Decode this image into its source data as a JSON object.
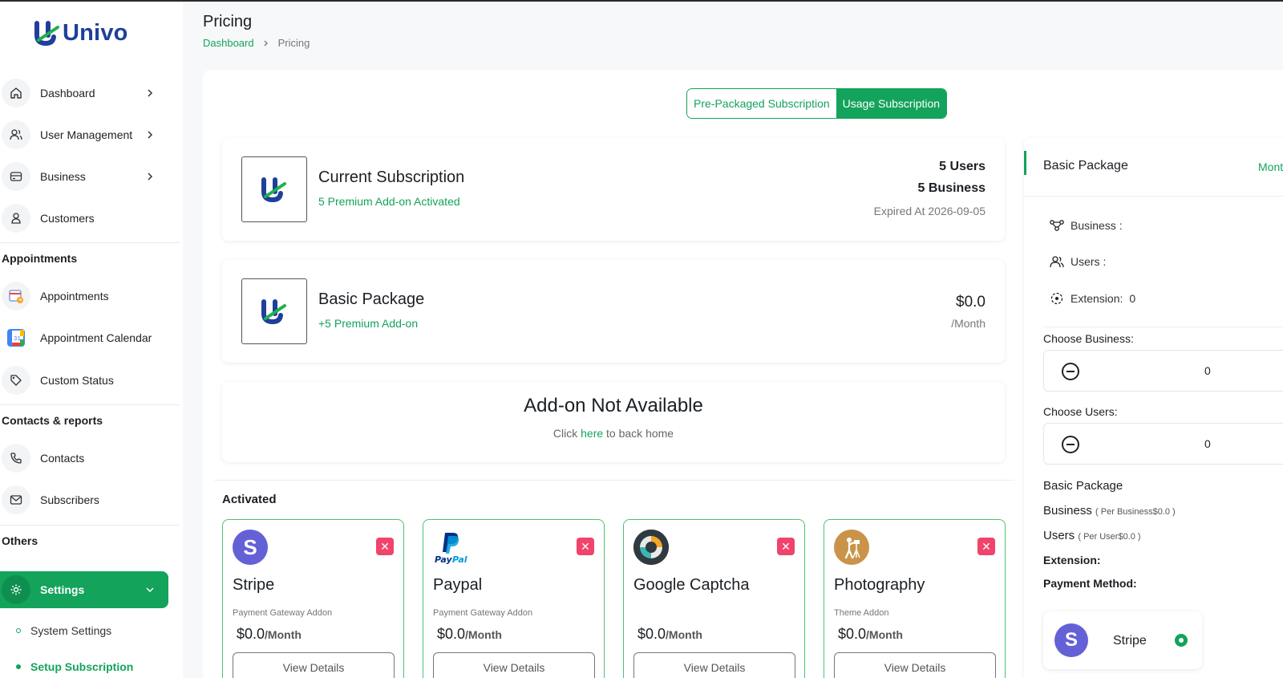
{
  "app": {
    "logo_text": "Univo"
  },
  "sidebar": {
    "items": [
      {
        "label": "Dashboard"
      },
      {
        "label": "User Management"
      },
      {
        "label": "Business"
      },
      {
        "label": "Customers"
      }
    ],
    "sections": [
      {
        "title": "Appointments",
        "items": [
          "Appointments",
          "Appointment Calendar",
          "Custom Status"
        ]
      },
      {
        "title": "Contacts & reports",
        "items": [
          "Contacts",
          "Subscribers"
        ]
      },
      {
        "title": "Others"
      }
    ],
    "active": {
      "label": "Settings"
    },
    "subitems": [
      {
        "label": "System Settings"
      },
      {
        "label": "Setup Subscription"
      }
    ]
  },
  "header": {
    "title": "Pricing",
    "breadcrumb": [
      "Dashboard",
      "Pricing"
    ]
  },
  "toggle": {
    "options": [
      "Pre-Packaged Subscription",
      "Usage Subscription"
    ],
    "selected": "Usage Subscription"
  },
  "current_subscription": {
    "title": "Current Subscription",
    "subtitle": "5 Premium Add-on Activated",
    "users": "5 Users",
    "business": "5 Business",
    "expiry": "Expired At 2026-09-05"
  },
  "package": {
    "title": "Basic Package",
    "subtitle": "+5 Premium Add-on",
    "price": "$0.0",
    "period": "/Month"
  },
  "addon_unavailable": {
    "title": "Add-on Not Available",
    "sub_prefix": "Click",
    "sub_link": "here",
    "sub_suffix": "to back home"
  },
  "activated": {
    "label": "Activated",
    "addons": [
      {
        "name": "Stripe",
        "type": "Payment Gateway Addon",
        "price": "$0.0",
        "period": "/Month",
        "button": "View Details",
        "icon": "stripe-icon"
      },
      {
        "name": "Paypal",
        "type": "Payment Gateway Addon",
        "price": "$0.0",
        "period": "/Month",
        "button": "View Details",
        "icon": "paypal-icon"
      },
      {
        "name": "Google Captcha",
        "type": "",
        "price": "$0.0",
        "period": "/Month",
        "button": "View Details",
        "icon": "captcha-icon"
      },
      {
        "name": "Photography",
        "type": "Theme Addon",
        "price": "$0.0",
        "period": "/Month",
        "button": "View Details",
        "icon": "photography-icon"
      }
    ]
  },
  "summary": {
    "title": "Basic Package",
    "period_tab": "Mont",
    "business_label": "Business :",
    "users_label": "Users :",
    "extension_label": "Extension:",
    "extension_value": "0",
    "choose_business_label": "Choose Business:",
    "choose_business_value": "0",
    "choose_users_label": "Choose Users:",
    "choose_users_value": "0",
    "package_name": "Basic Package",
    "business_line": "Business",
    "business_note": "( Per Business$0.0 )",
    "users_line": "Users",
    "users_note": "( Per User$0.0 )",
    "extension_line": "Extension:",
    "payment_method_label": "Payment Method:",
    "payment_method": "Stripe"
  },
  "colors": {
    "accent": "#13a35b",
    "danger": "#f0446c",
    "brand": "#1f3f9b"
  }
}
